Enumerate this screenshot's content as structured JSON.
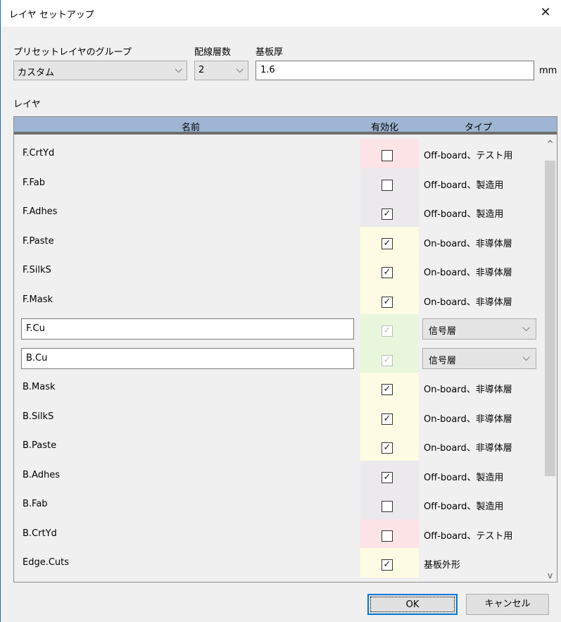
{
  "window": {
    "title": "レイヤ セットアップ",
    "close_label": "✕"
  },
  "preset": {
    "label": "プリセットレイヤのグループ",
    "value": "カスタム"
  },
  "copper_layers": {
    "label": "配線層数",
    "value": "2"
  },
  "thickness": {
    "label": "基板厚",
    "value": "1.6",
    "unit": "mm"
  },
  "layers_section": {
    "label": "レイヤ"
  },
  "table": {
    "headers": {
      "name": "名前",
      "enabled": "有効化",
      "type": "タイプ"
    },
    "rows": [
      {
        "name": "F.CrtYd",
        "enabled": false,
        "type": "Off-board、テスト用",
        "color": "#fbe3e6"
      },
      {
        "name": "F.Fab",
        "enabled": false,
        "type": "Off-board、製造用",
        "color": "#ebe9ec"
      },
      {
        "name": "F.Adhes",
        "enabled": true,
        "type": "Off-board、製造用",
        "color": "#ebe9ec"
      },
      {
        "name": "F.Paste",
        "enabled": true,
        "type": "On-board、非導体層",
        "color": "#fdfbe3"
      },
      {
        "name": "F.SilkS",
        "enabled": true,
        "type": "On-board、非導体層",
        "color": "#fdfbe3"
      },
      {
        "name": "F.Mask",
        "enabled": true,
        "type": "On-board、非導体層",
        "color": "#fdfbe3"
      },
      {
        "name": "F.Cu",
        "enabled": true,
        "type": "信号層",
        "color": "#e8f7dc",
        "editable": true
      },
      {
        "name": "B.Cu",
        "enabled": true,
        "type": "信号層",
        "color": "#e8f7dc",
        "editable": true
      },
      {
        "name": "B.Mask",
        "enabled": true,
        "type": "On-board、非導体層",
        "color": "#fdfbe3"
      },
      {
        "name": "B.SilkS",
        "enabled": true,
        "type": "On-board、非導体層",
        "color": "#fdfbe3"
      },
      {
        "name": "B.Paste",
        "enabled": true,
        "type": "On-board、非導体層",
        "color": "#fdfbe3"
      },
      {
        "name": "B.Adhes",
        "enabled": true,
        "type": "Off-board、製造用",
        "color": "#ebe9ec"
      },
      {
        "name": "B.Fab",
        "enabled": false,
        "type": "Off-board、製造用",
        "color": "#ebe9ec"
      },
      {
        "name": "B.CrtYd",
        "enabled": false,
        "type": "Off-board、テスト用",
        "color": "#fbe3e6"
      },
      {
        "name": "Edge.Cuts",
        "enabled": true,
        "type": "基板外形",
        "color": "#fdfbe3"
      }
    ]
  },
  "buttons": {
    "ok": "OK",
    "cancel": "キャンセル"
  },
  "icons": {
    "check": "✓",
    "chevron": "⌵",
    "scroll_up": "^",
    "scroll_down": "v"
  }
}
